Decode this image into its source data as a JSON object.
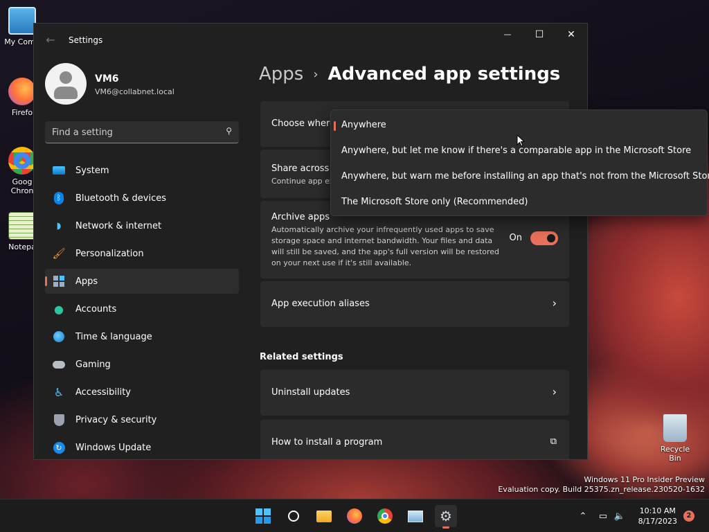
{
  "desktop": {
    "icons": [
      {
        "label": "My Comp",
        "icon": "monitor-icon"
      },
      {
        "label": "Firefo",
        "icon": "firefox-icon"
      },
      {
        "label": "Goog Chron",
        "icon": "chrome-icon"
      },
      {
        "label": "Notepa",
        "icon": "notepad-icon"
      }
    ],
    "recycle_bin": "Recycle Bin",
    "watermark_line1": "Windows 11 Pro Insider Preview",
    "watermark_line2": "Evaluation copy. Build 25375.zn_release.230520-1632"
  },
  "window": {
    "title": "Settings",
    "minimize": "—",
    "maximize": "☐",
    "close": "✕"
  },
  "user": {
    "name": "VM6",
    "email": "VM6@collabnet.local"
  },
  "search": {
    "placeholder": "Find a setting"
  },
  "nav": {
    "items": [
      {
        "label": "System",
        "icon": "system-icon"
      },
      {
        "label": "Bluetooth & devices",
        "icon": "bluetooth-icon"
      },
      {
        "label": "Network & internet",
        "icon": "wifi-icon"
      },
      {
        "label": "Personalization",
        "icon": "brush-icon"
      },
      {
        "label": "Apps",
        "icon": "apps-icon",
        "active": true
      },
      {
        "label": "Accounts",
        "icon": "accounts-icon"
      },
      {
        "label": "Time & language",
        "icon": "globe-icon"
      },
      {
        "label": "Gaming",
        "icon": "gamepad-icon"
      },
      {
        "label": "Accessibility",
        "icon": "accessibility-icon"
      },
      {
        "label": "Privacy & security",
        "icon": "shield-icon"
      },
      {
        "label": "Windows Update",
        "icon": "update-icon"
      }
    ]
  },
  "main": {
    "breadcrumb_parent": "Apps",
    "breadcrumb_sep": "›",
    "breadcrumb_current": "Advanced app settings",
    "choose_where": "Choose where",
    "share_across": "Share across d",
    "share_desc": "Continue app ex",
    "archive_title": "Archive apps",
    "archive_desc": "Automatically archive your infrequently used apps to save storage space and internet bandwidth. Your files and data will still be saved, and the app's full version will be restored on your next use if it's still available.",
    "archive_toggle_label": "On",
    "execution_aliases": "App execution aliases",
    "related_title": "Related settings",
    "uninstall_updates": "Uninstall updates",
    "how_to_install": "How to install a program"
  },
  "dropdown": {
    "options": [
      "Anywhere",
      "Anywhere, but let me know if there's a comparable app in the Microsoft Store",
      "Anywhere, but warn me before installing an app that's not from the Microsoft Store",
      "The Microsoft Store only (Recommended)"
    ],
    "selected_index": 0
  },
  "taskbar": {
    "time": "10:10 AM",
    "date": "8/17/2023",
    "notification_count": "2"
  },
  "colors": {
    "accent": "#e8705a",
    "window_bg": "#202020",
    "card_bg": "#2b2b2b"
  }
}
